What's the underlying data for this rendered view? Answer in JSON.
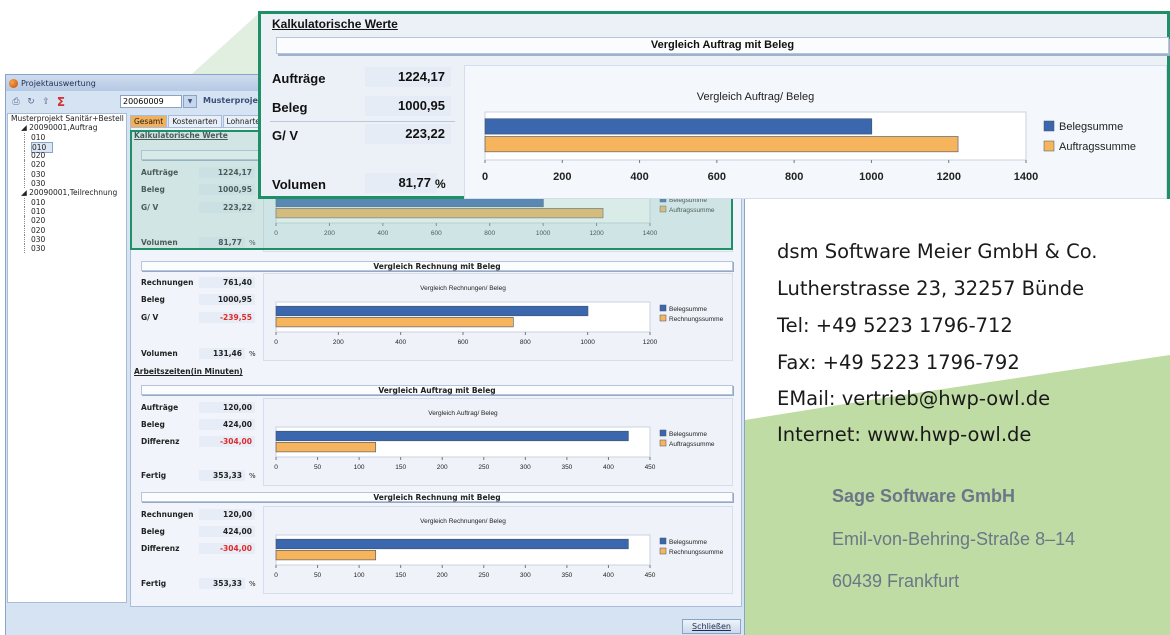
{
  "colors": {
    "accent_green": "#1f8f68",
    "bar_beleg": "#3a67ad",
    "bar_auftrag": "#f6b45d",
    "negative": "#e02a2a",
    "bg_green": "#bfdca4"
  },
  "window": {
    "title": "Projektauswertung",
    "project_number": "20060009",
    "project_name": "Musterprojekt",
    "close_label": "Schließen",
    "toolbar_icons": [
      "printer-icon",
      "refresh-icon",
      "export-icon",
      "sigma-icon"
    ]
  },
  "tree": {
    "root": "Musterprojekt Sanitär+Bestell",
    "groups": [
      {
        "label": "20090001,Auftrag",
        "children": [
          "010",
          "010",
          "020",
          "020",
          "030",
          "030"
        ]
      },
      {
        "label": "20090001,Teilrechnung",
        "children": [
          "010",
          "010",
          "020",
          "020",
          "030",
          "030"
        ]
      }
    ]
  },
  "tabs": [
    "Gesamt",
    "Kostenarten",
    "Lohnarten"
  ],
  "sections": {
    "kalk_title": "Kalkulatorische Werte",
    "arbeit_title": "Arbeitszeiten(in Minuten)"
  },
  "kalk_auftrag": {
    "bar_title": "Vergleich Auftrag mit Beleg",
    "chart_title": "Vergleich Auftrag/ Beleg",
    "rows": [
      {
        "label": "Aufträge",
        "value": "1224,17"
      },
      {
        "label": "Beleg",
        "value": "1000,95"
      },
      {
        "label": "G/ V",
        "value": "223,22"
      }
    ],
    "footer_label": "Volumen",
    "footer_value": "81,77",
    "footer_unit": "%"
  },
  "kalk_rechnung": {
    "bar_title": "Vergleich Rechnung mit Beleg",
    "chart_title": "Vergleich Rechnungen/ Beleg",
    "rows": [
      {
        "label": "Rechnungen",
        "value": "761,40"
      },
      {
        "label": "Beleg",
        "value": "1000,95"
      },
      {
        "label": "G/ V",
        "value": "-239,55"
      }
    ],
    "footer_label": "Volumen",
    "footer_value": "131,46",
    "footer_unit": "%"
  },
  "arbeit_auftrag": {
    "bar_title": "Vergleich Auftrag mit Beleg",
    "chart_title": "Vergleich Auftrag/ Beleg",
    "rows": [
      {
        "label": "Aufträge",
        "value": "120,00"
      },
      {
        "label": "Beleg",
        "value": "424,00"
      },
      {
        "label": "Differenz",
        "value": "-304,00"
      }
    ],
    "footer_label": "Fertig",
    "footer_value": "353,33",
    "footer_unit": "%"
  },
  "arbeit_rechnung": {
    "bar_title": "Vergleich Rechnung mit Beleg",
    "chart_title": "Vergleich Rechnungen/ Beleg",
    "rows": [
      {
        "label": "Rechnungen",
        "value": "120,00"
      },
      {
        "label": "Beleg",
        "value": "424,00"
      },
      {
        "label": "Differenz",
        "value": "-304,00"
      }
    ],
    "footer_label": "Fertig",
    "footer_value": "353,33",
    "footer_unit": "%"
  },
  "zoom": {
    "title": "Kalkulatorische Werte",
    "bar_title": "Vergleich Auftrag mit Beleg",
    "chart_title": "Vergleich Auftrag/ Beleg",
    "rows": [
      {
        "label": "Aufträge",
        "value": "1224,17"
      },
      {
        "label": "Beleg",
        "value": "1000,95"
      },
      {
        "label": "G/ V",
        "value": "223,22"
      }
    ],
    "footer_label": "Volumen",
    "footer_value": "81,77",
    "footer_unit": "%"
  },
  "chart_data": [
    {
      "type": "bar",
      "orientation": "horizontal",
      "title": "Vergleich Auftrag/ Beleg",
      "series": [
        {
          "name": "Belegsumme",
          "values": [
            1000.95
          ]
        },
        {
          "name": "Auftragssumme",
          "values": [
            1224.17
          ]
        }
      ],
      "xlim": [
        0,
        1400
      ],
      "xticks": [
        "0",
        "200",
        "400",
        "600",
        "800",
        "1000",
        "1200",
        "1400"
      ],
      "legend": "right"
    },
    {
      "type": "bar",
      "orientation": "horizontal",
      "title": "Vergleich Rechnungen/ Beleg",
      "series": [
        {
          "name": "Belegsumme",
          "values": [
            1000.95
          ]
        },
        {
          "name": "Rechnungssumme",
          "values": [
            761.4
          ]
        }
      ],
      "xlim": [
        0,
        1200
      ],
      "xticks": [
        "0",
        "200",
        "400",
        "600",
        "800",
        "1000",
        "1200"
      ],
      "legend": "right"
    },
    {
      "type": "bar",
      "orientation": "horizontal",
      "title": "Vergleich Auftrag/ Beleg",
      "series": [
        {
          "name": "Belegsumme",
          "values": [
            424
          ]
        },
        {
          "name": "Auftragssumme",
          "values": [
            120
          ]
        }
      ],
      "xlim": [
        0,
        450
      ],
      "xticks": [
        "0",
        "50",
        "100",
        "150",
        "200",
        "250",
        "300",
        "350",
        "400",
        "450"
      ],
      "legend": "right"
    },
    {
      "type": "bar",
      "orientation": "horizontal",
      "title": "Vergleich Rechnungen/ Beleg",
      "series": [
        {
          "name": "Belegsumme",
          "values": [
            424
          ]
        },
        {
          "name": "Rechnungssumme",
          "values": [
            120
          ]
        }
      ],
      "xlim": [
        0,
        450
      ],
      "xticks": [
        "0",
        "50",
        "100",
        "150",
        "200",
        "250",
        "300",
        "350",
        "400",
        "450"
      ],
      "legend": "right"
    }
  ],
  "address": {
    "company": "dsm Software Meier GmbH & Co.",
    "street": "Lutherstrasse 23, 32257 Bünde",
    "tel": "Tel: +49 5223 1796-712",
    "fax": "Fax: +49 5223 1796-792",
    "email": "EMail: vertrieb@hwp-owl.de",
    "web": "Internet: www.hwp-owl.de"
  },
  "sage": {
    "company": "Sage Software GmbH",
    "street": "Emil-von-Behring-Straße 8–14",
    "city": "60439 Frankfurt"
  }
}
